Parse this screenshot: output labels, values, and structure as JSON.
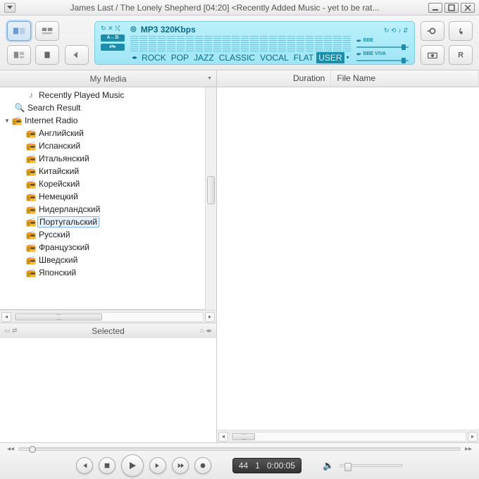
{
  "title": "James Last / The Lonely Shepherd  [04:20]    <Recently Added Music - yet to be rat...",
  "lcd": {
    "format": "MP3 320Kbps",
    "badge_ab": "A↔B",
    "eq_presets": [
      "ROCK",
      "POP",
      "JAZZ",
      "CLASSIC",
      "VOCAL",
      "FLAT",
      "USER"
    ],
    "eq_selected": "USER",
    "right_label1": "BBE",
    "right_label2": "BBE VIVA"
  },
  "left_pane": {
    "header": "My Media",
    "tree": {
      "recentlyPlayed": "Recently Played Music",
      "searchResult": "Search Result",
      "internetRadio": "Internet Radio",
      "stations": [
        "Английский",
        "Испанский",
        "Итальянский",
        "Китайский",
        "Корейский",
        "Немецкий",
        "Нидерландский",
        "Португальский",
        "Русский",
        "Французский",
        "Шведский",
        "Японский"
      ]
    },
    "selected_header": "Selected"
  },
  "columns": {
    "duration": "Duration",
    "filename": "File Name"
  },
  "playback": {
    "track_no": "44",
    "index": "1",
    "elapsed": "0:00:05"
  }
}
